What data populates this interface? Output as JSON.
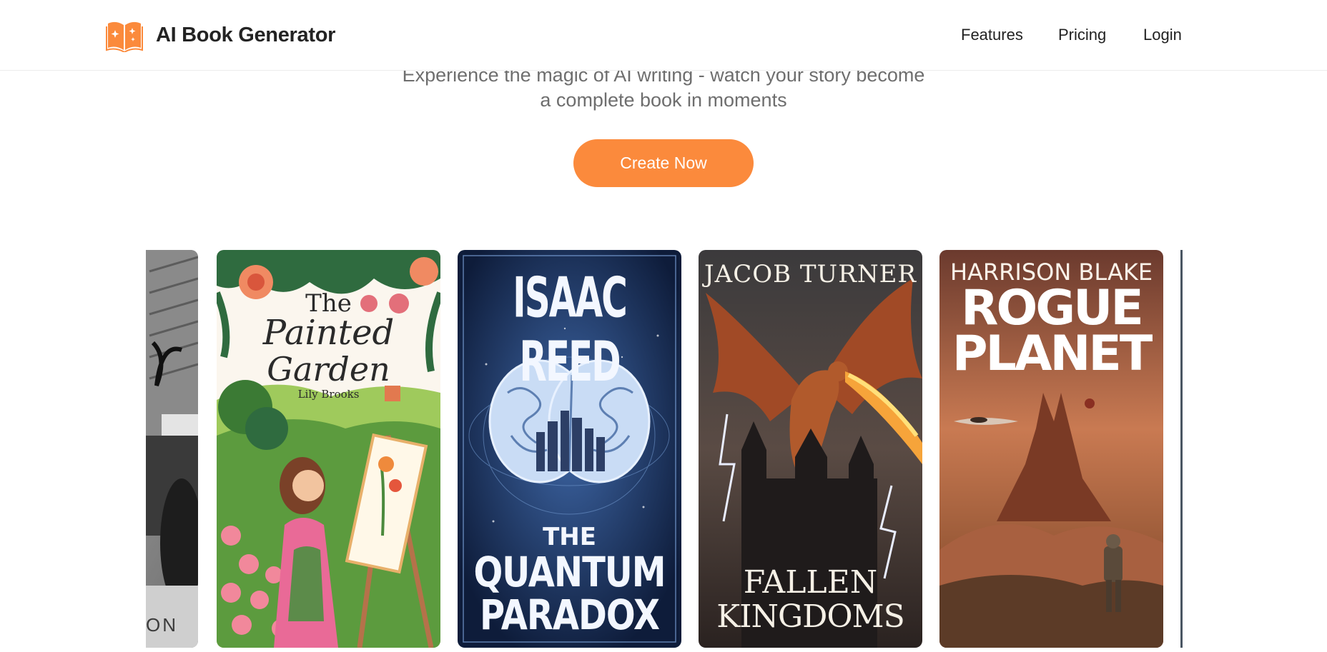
{
  "header": {
    "brand": "AI Book Generator",
    "logo_icon": "open-book-sparkle-icon",
    "nav": [
      {
        "label": "Features"
      },
      {
        "label": "Pricing"
      },
      {
        "label": "Login"
      }
    ]
  },
  "hero": {
    "subtitle_line1": "Experience the magic of AI writing - watch your story become",
    "subtitle_line2": "a complete book in moments",
    "cta_label": "Create Now"
  },
  "books": [
    {
      "partial_text": "ON"
    },
    {
      "title": "The Painted Garden",
      "title_line1": "The",
      "title_line2": "Painted",
      "title_line3": "Garden",
      "author": "Lily Brooks"
    },
    {
      "author": "ISAAC REED",
      "title_line1": "THE",
      "title_line2": "QUANTUM",
      "title_line3": "PARADOX"
    },
    {
      "author": "JACOB TURNER",
      "title_line1": "FALLEN",
      "title_line2": "KINGDOMS"
    },
    {
      "author": "HARRISON BLAKE",
      "title_line1": "ROGUE",
      "title_line2": "PLANET"
    }
  ],
  "colors": {
    "accent": "#fb8a3c",
    "text_dark": "#232323",
    "text_muted": "#6e6e6e"
  }
}
